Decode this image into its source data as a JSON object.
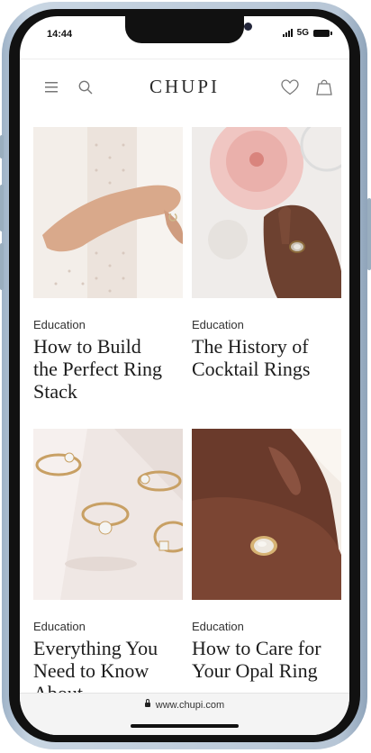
{
  "status_bar": {
    "time": "14:44",
    "network": "5G"
  },
  "header": {
    "brand": "CHUPI"
  },
  "articles": [
    {
      "category": "Education",
      "title": "How to Build the Perfect Ring Stack"
    },
    {
      "category": "Education",
      "title": "The History of Cocktail Rings"
    },
    {
      "category": "Education",
      "title": "Everything You Need to Know About"
    },
    {
      "category": "Education",
      "title": "How to Care for Your Opal Ring"
    }
  ],
  "browser": {
    "url": "www.chupi.com"
  },
  "icons": {
    "menu": "hamburger-menu-icon",
    "search": "search-icon",
    "wishlist": "heart-icon",
    "cart": "shopping-bag-icon"
  }
}
